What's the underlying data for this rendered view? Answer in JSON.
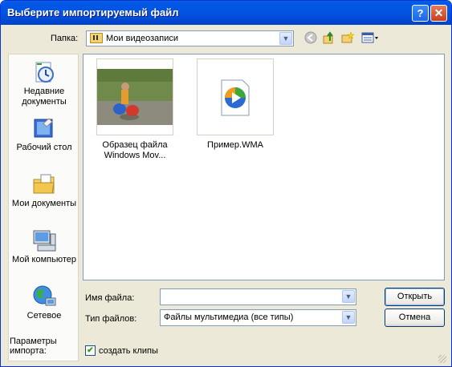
{
  "window": {
    "title": "Выберите импортируемый файл"
  },
  "lookin": {
    "label": "Папка:",
    "value": "Мои видеозаписи"
  },
  "places": [
    {
      "label": "Недавние документы"
    },
    {
      "label": "Рабочий стол"
    },
    {
      "label": "Мои документы"
    },
    {
      "label": "Мой компьютер"
    },
    {
      "label": "Сетевое"
    }
  ],
  "files": [
    {
      "label": "Образец файла Windows Mov..."
    },
    {
      "label": "Пример.WMA"
    }
  ],
  "filename": {
    "label": "Имя файла:",
    "value": ""
  },
  "filetype": {
    "label": "Тип файлов:",
    "value": "Файлы мультимедиа (все типы)"
  },
  "buttons": {
    "open": "Открыть",
    "cancel": "Отмена"
  },
  "options": {
    "label": "Параметры импорта:",
    "checkbox_label": "создать клипы",
    "checked": true
  }
}
